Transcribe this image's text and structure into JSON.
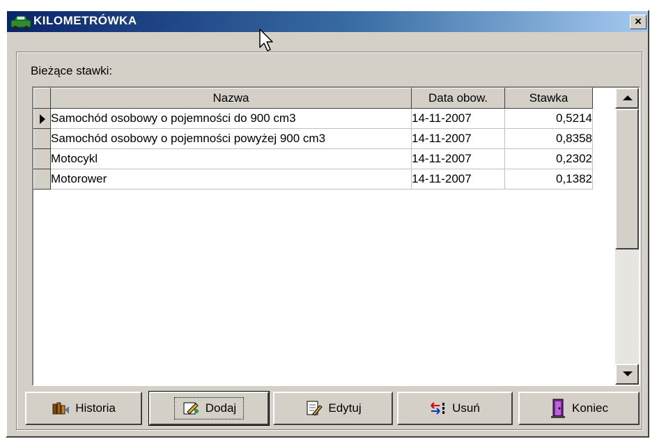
{
  "window": {
    "title": "KILOMETRÓWKA",
    "close_label": "×"
  },
  "group": {
    "label": "Bieżące stawki:"
  },
  "grid": {
    "columns": [
      "Nazwa",
      "Data obow.",
      "Stawka"
    ],
    "rows": [
      {
        "name": "Samochód osobowy o pojemności do 900 cm3",
        "date": "14-11-2007",
        "rate": "0,5214",
        "selected": true
      },
      {
        "name": "Samochód osobowy o pojemności powyżej 900 cm3",
        "date": "14-11-2007",
        "rate": "0,8358",
        "selected": false
      },
      {
        "name": "Motocykl",
        "date": "14-11-2007",
        "rate": "0,2302",
        "selected": false
      },
      {
        "name": "Motorower",
        "date": "14-11-2007",
        "rate": "0,1382",
        "selected": false
      }
    ]
  },
  "buttons": {
    "history": {
      "label": "Historia",
      "icon": "books-icon"
    },
    "add": {
      "label": "Dodaj",
      "icon": "add-pencil-icon"
    },
    "edit": {
      "label": "Edytuj",
      "icon": "edit-document-icon"
    },
    "delete": {
      "label": "Usuń",
      "icon": "delete-arrows-icon"
    },
    "close": {
      "label": "Koniec",
      "icon": "exit-door-icon"
    }
  },
  "colors": {
    "title_start": "#0a246a",
    "title_end": "#a6caf0",
    "face": "#d4d0c8"
  }
}
